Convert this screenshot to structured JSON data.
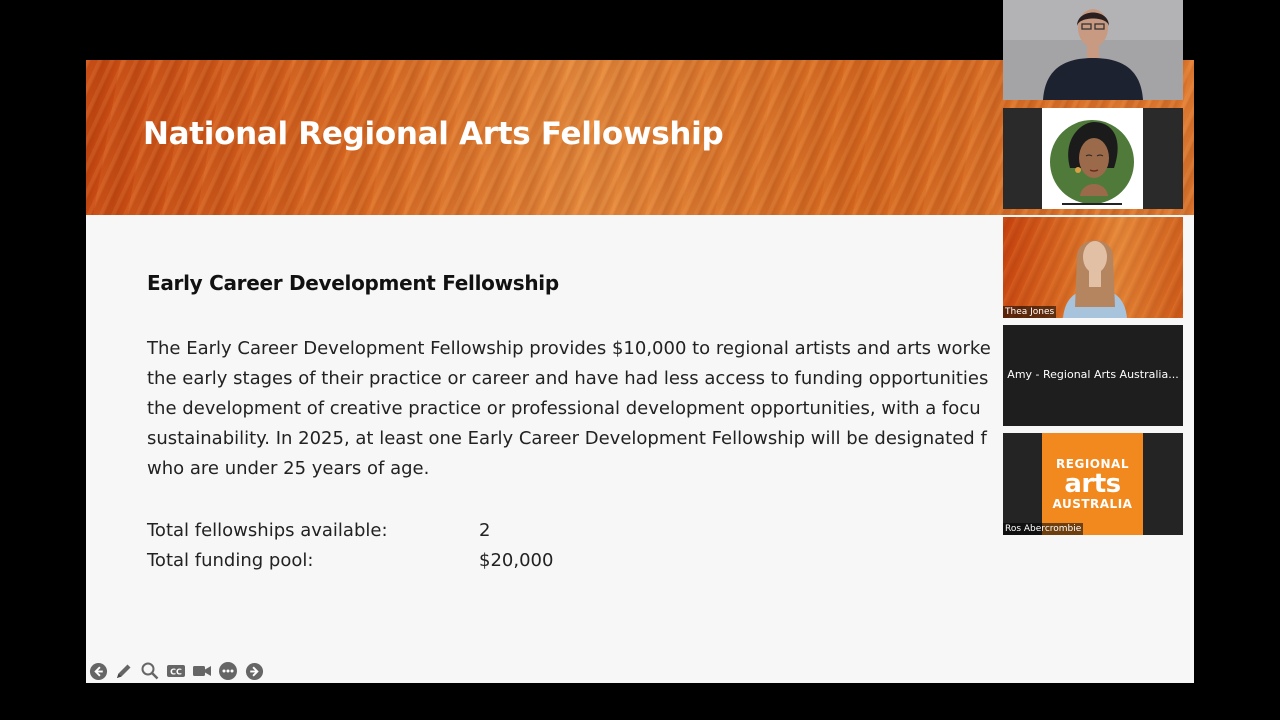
{
  "slide": {
    "title": "National Regional Arts Fellowship",
    "heading": "Early Career Development Fellowship",
    "paragraph_lines": [
      "The Early Career Development Fellowship provides $10,000 to regional artists and arts worke",
      "the early stages of their practice or career and have had less access to funding opportunities",
      "the development of creative practice or professional development opportunities, with a focu",
      "sustainability. In 2025, at least one Early Career Development Fellowship will be designated f",
      "who are under 25 years of age."
    ],
    "stats": [
      {
        "label": "Total fellowships available:",
        "value": "2"
      },
      {
        "label": "Total funding pool:",
        "value": "$20,000"
      }
    ]
  },
  "toolbar": {
    "icons": [
      "back-arrow-icon",
      "pen-icon",
      "zoom-icon",
      "closed-captions-icon",
      "video-camera-icon",
      "more-options-icon",
      "forward-arrow-icon"
    ],
    "cc_label": "CC"
  },
  "participants": [
    {
      "name": ""
    },
    {
      "name": ""
    },
    {
      "name": "Thea Jones"
    },
    {
      "name": "Amy - Regional Arts Australia..."
    },
    {
      "name": "Ros Abercrombie"
    }
  ],
  "logo": {
    "line1": "REGIONAL",
    "line2": "arts",
    "line3": "AUSTRALIA"
  },
  "colors": {
    "banner_orange": "#d96a22",
    "slide_bg": "#f7f7f7",
    "logo_orange": "#f2891f",
    "text": "#222222"
  }
}
